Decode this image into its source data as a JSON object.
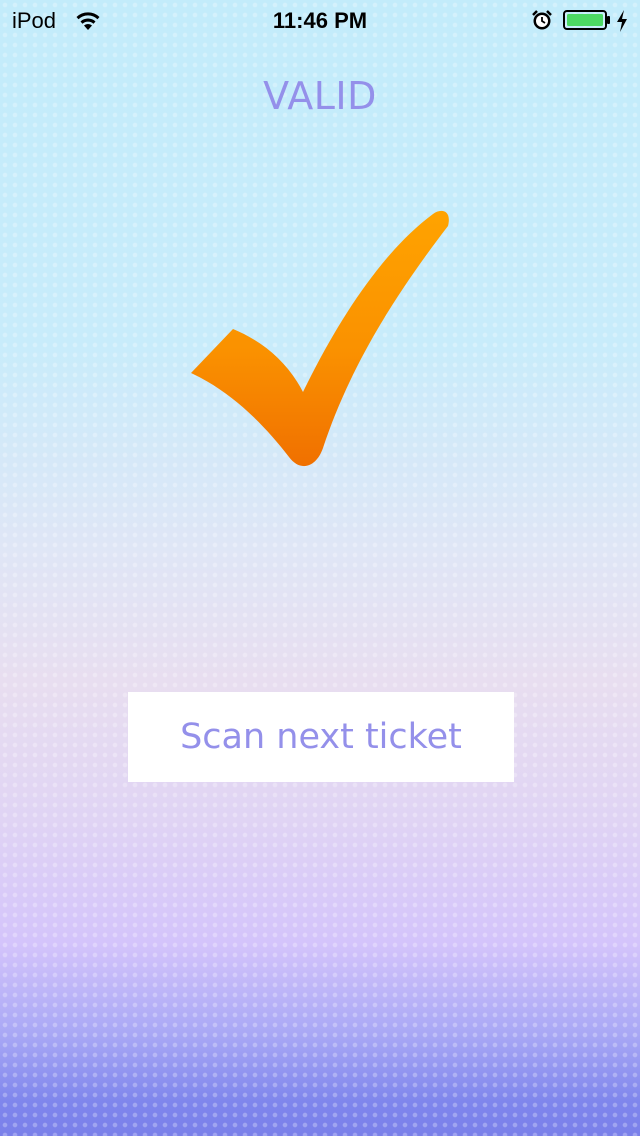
{
  "status_bar": {
    "carrier": "iPod",
    "time": "11:46 PM",
    "icons": [
      "wifi-icon",
      "alarm-icon",
      "battery-icon",
      "charging-icon"
    ],
    "battery_color": "#4cd964"
  },
  "result": {
    "title": "VALID",
    "icon": "checkmark-icon",
    "icon_color": "#ff9a00"
  },
  "actions": {
    "scan_next_label": "Scan next ticket"
  },
  "colors": {
    "accent_text": "#9490ea",
    "button_background": "#ffffff"
  }
}
